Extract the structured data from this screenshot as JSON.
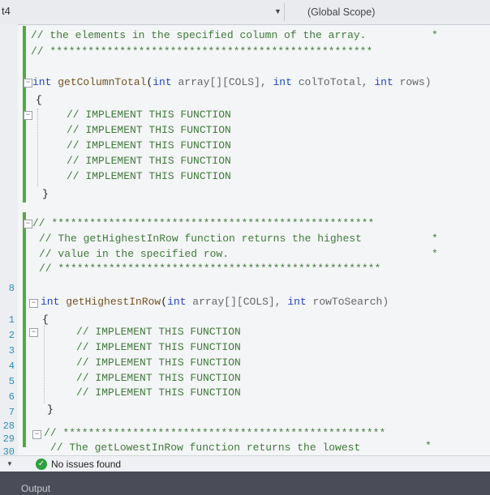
{
  "nav": {
    "project_label": "t4",
    "scope_label": "(Global Scope)"
  },
  "line_numbers": [
    "8",
    "1",
    "2",
    "3",
    "4",
    "5",
    "6",
    "7",
    "28",
    "29",
    "30"
  ],
  "code": {
    "l1": "// the elements in the specified column of the array.",
    "l1_star": "*",
    "l2": "// ***************************************************",
    "sig1_kw1": "int",
    "sig1_fn": "getColumnTotal",
    "sig1_open": "(",
    "sig1_kw2": "int",
    "sig1_p1": "array[][COLS],",
    "sig1_kw3": "int",
    "sig1_p2": "colToTotal,",
    "sig1_kw4": "int",
    "sig1_p3": "rows)",
    "brace_open": "{",
    "brace_close": "}",
    "impl": "// IMPLEMENT THIS FUNCTION",
    "c_stars": "// ***************************************************",
    "c_desc1": "// The getHighestInRow function returns the highest",
    "c_desc1_star": "*",
    "c_desc2": "// value in the specified row.",
    "c_desc2_star": "*",
    "c_end": "// ***************************************************",
    "sig2_kw1": "int",
    "sig2_fn": "getHighestInRow",
    "sig2_open": "(",
    "sig2_kw2": "int",
    "sig2_p1": "array[][COLS],",
    "sig2_kw3": "int",
    "sig2_p2": "rowToSearch)",
    "c3_stars": "// ***************************************************",
    "c3_desc": "// The getLowestInRow function returns the lowest",
    "c3_star": "*"
  },
  "status": {
    "text": "No issues found"
  },
  "bottom": {
    "output_tab": "Output"
  }
}
